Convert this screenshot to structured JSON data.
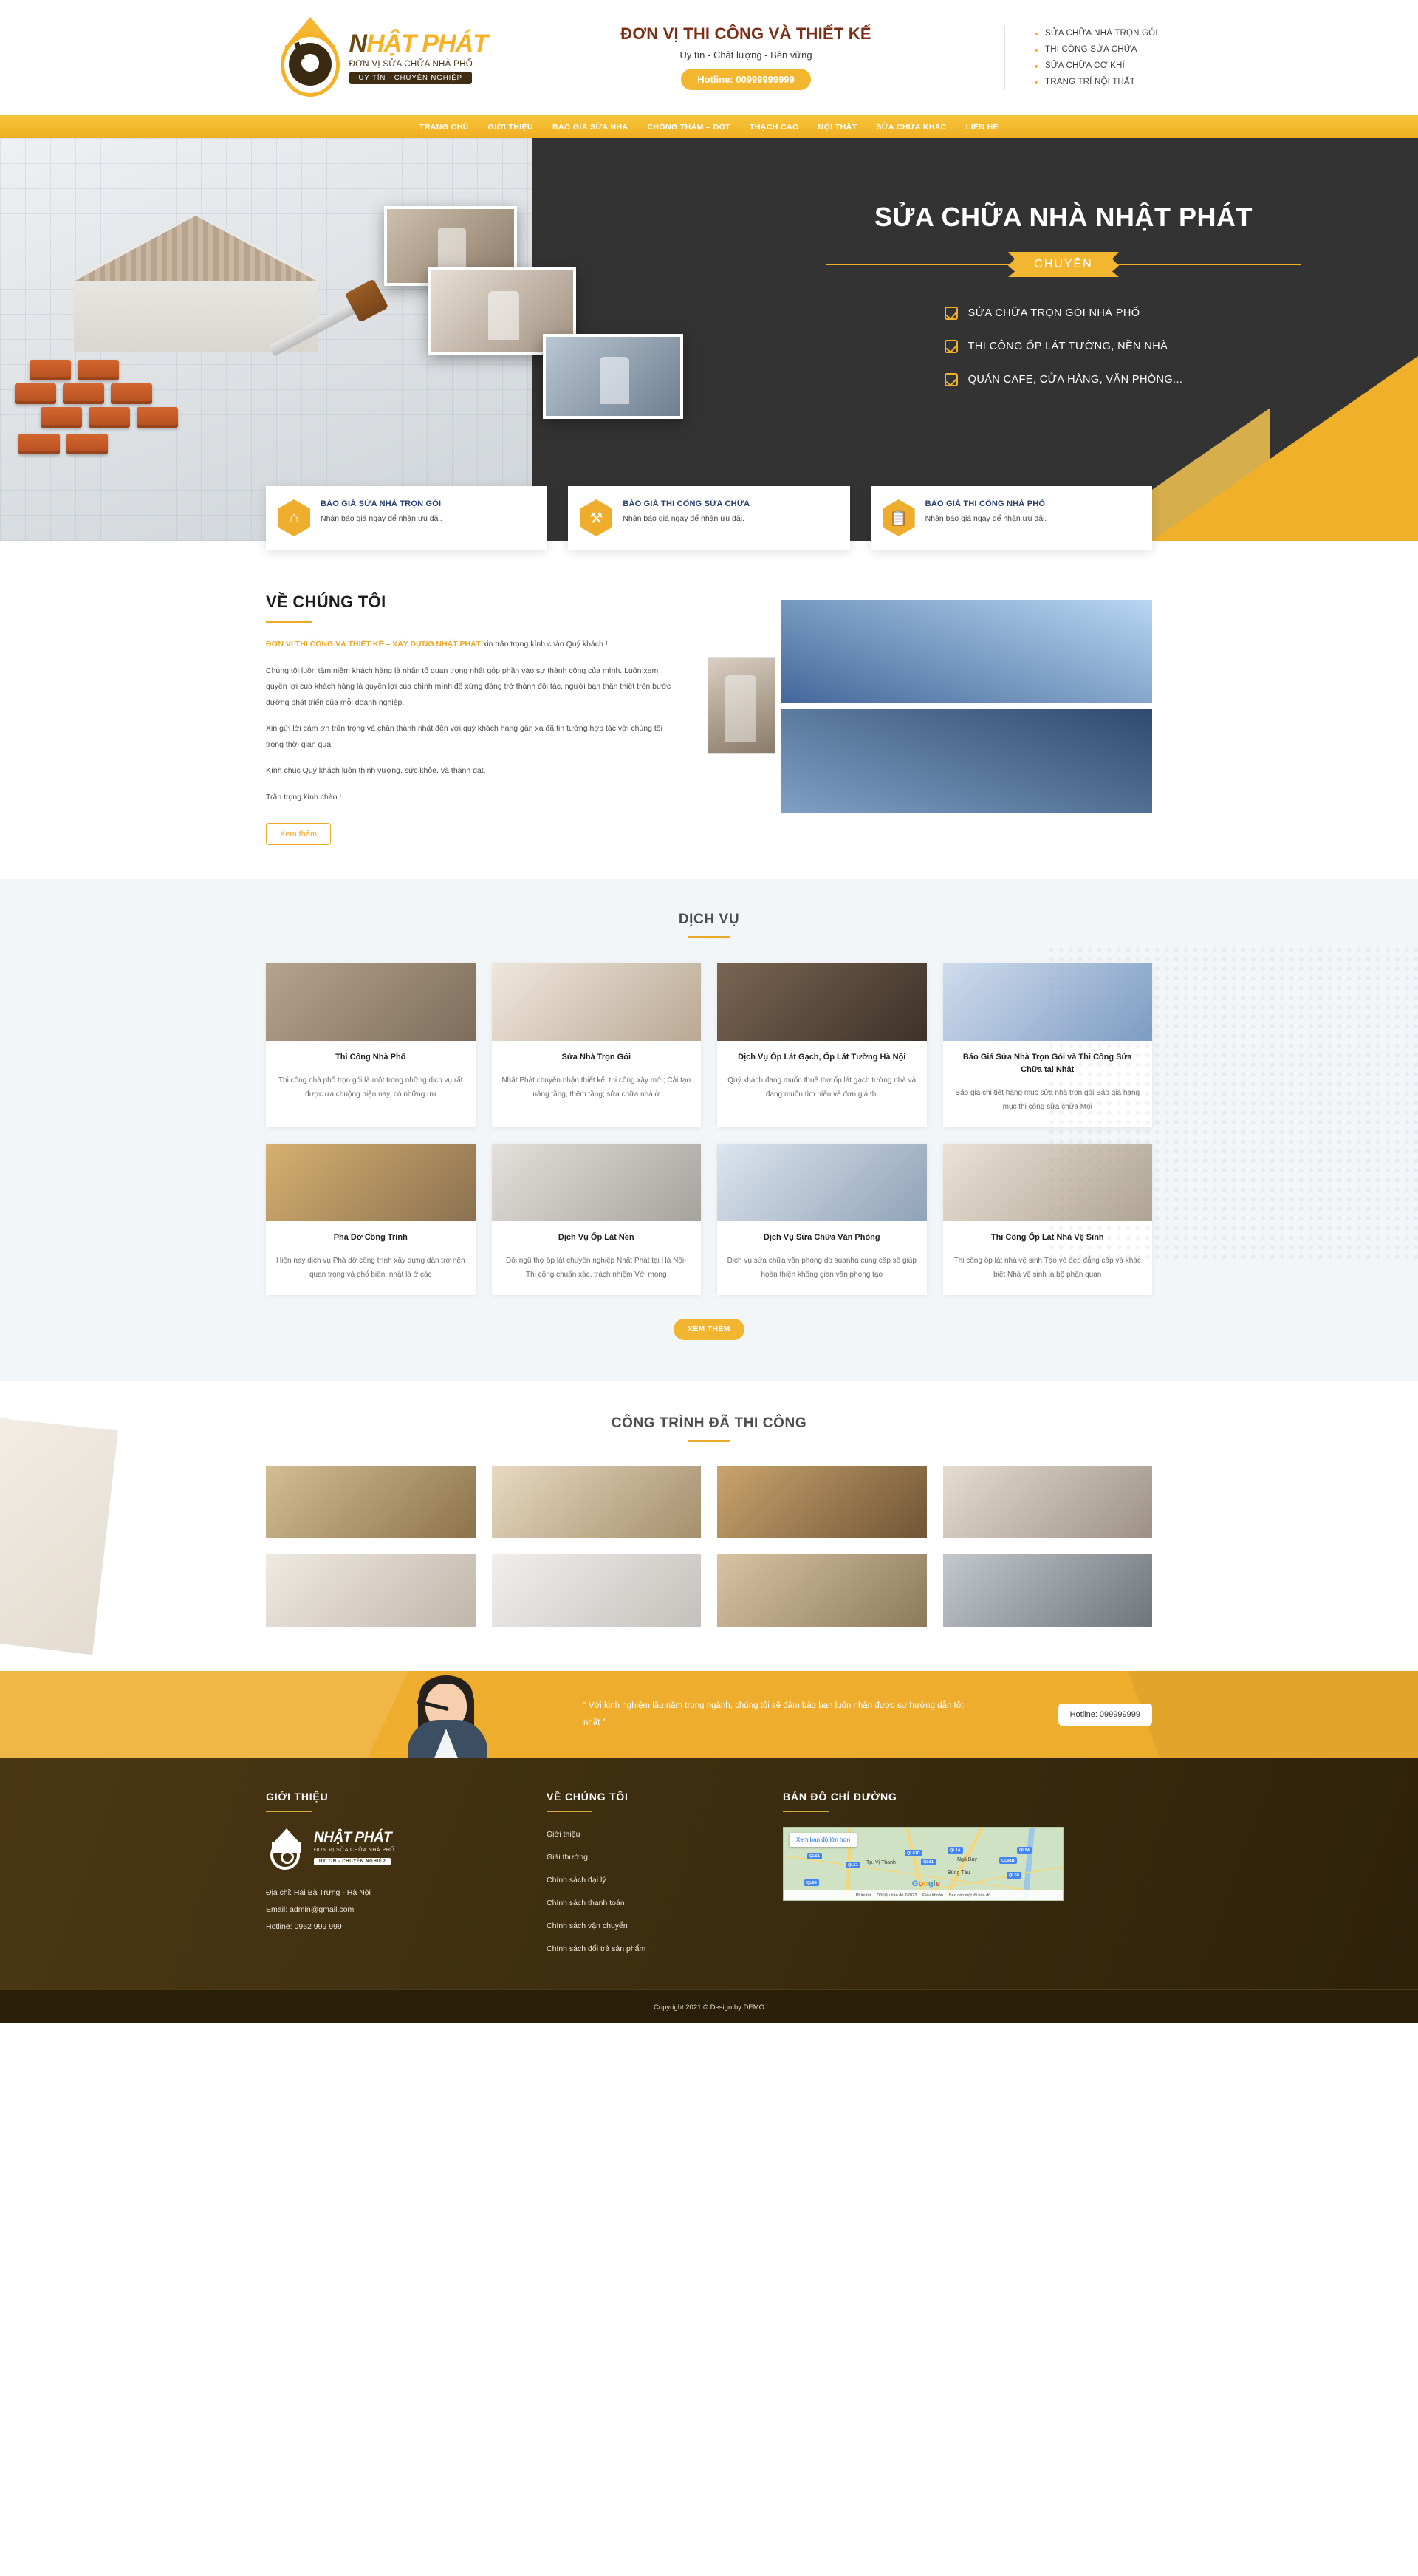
{
  "header": {
    "logo": {
      "name_first": "N",
      "name_rest": "HẬT PHÁT",
      "subtitle": "ĐƠN VỊ SỬA CHỮA NHÀ PHỐ",
      "badge": "UY TÍN - CHUYÊN NGHIỆP"
    },
    "center": {
      "title": "ĐƠN VỊ THI CÔNG VÀ THIẾT KẾ",
      "slogan": "Uy tín - Chất lượng - Bền vững",
      "hotline": "Hotline: 00999999999"
    },
    "services_list": [
      "SỬA CHỮA NHÀ TRỌN GÓI",
      "THI CÔNG SỬA CHỮA",
      "SỬA CHỮA CƠ KHÍ",
      "TRANG TRÍ NỘI THẤT"
    ]
  },
  "nav": {
    "items": [
      "TRANG CHỦ",
      "GIỚI THIỆU",
      "BÁO GIÁ SỬA NHÀ",
      "CHỐNG THẤM – DỘT",
      "THẠCH CAO",
      "NỘI THẤT",
      "SỬA CHỮA KHÁC",
      "LIÊN HỆ"
    ]
  },
  "hero": {
    "title": "SỬA CHỮA NHÀ NHẬT PHÁT",
    "ribbon": "CHUYÊN",
    "bullets": [
      "SỬA CHỮA TRỌN GÓI NHÀ PHỐ",
      "THI CÔNG ỐP LÁT TƯỜNG, NỀN NHÀ",
      "QUÁN CAFE, CỬA HÀNG, VĂN PHÒNG..."
    ]
  },
  "quote_cards": [
    {
      "icon": "house-icon",
      "title": "BÁO GIÁ SỬA NHÀ TRỌN GÓI",
      "desc": "Nhận báo giá ngay để nhận ưu đãi."
    },
    {
      "icon": "tools-icon",
      "title": "BÁO GIÁ THI CÔNG SỬA CHỮA",
      "desc": "Nhận báo giá ngay để nhận ưu đãi."
    },
    {
      "icon": "clipboard-icon",
      "title": "BÁO GIÁ THI CÔNG NHÀ PHỐ",
      "desc": "Nhận báo giá ngay để nhận ưu đãi."
    }
  ],
  "about": {
    "heading": "VỀ CHÚNG TÔI",
    "lead_highlight": "ĐƠN VỊ THI CÔNG VÀ THIẾT KẾ – XÂY DỰNG NHẬT PHÁT",
    "lead_rest": " xin trân trọng kính chào Quý khách !",
    "p1": "Chúng tôi luôn tâm niệm khách hàng là nhân tố quan trọng nhất góp phần vào sự thành công của mình. Luôn xem quyền lợi của khách hàng là quyền lợi của chính mình để xứng đáng trở thành đối tác, người bạn thân thiết trên bước đường phát triển của mỗi doanh nghiệp.",
    "p2": "Xin gửi lời cảm ơn trân trọng và chân thành nhất đến với quý khách hàng gần xa đã tin tưởng hợp tác với chúng tôi trong thời gian qua.",
    "p3": "Kính chúc Quý khách luôn thịnh vượng, sức khỏe, và thành đạt.",
    "p4": "Trân trọng kính chào !",
    "button": "Xem thêm"
  },
  "services": {
    "heading": "DỊCH VỤ",
    "more_button": "XEM THÊM",
    "cards": [
      {
        "title": "Thi Công Nhà Phố",
        "desc": "Thi công nhà phố trọn gói là một trong những dịch vụ rất được ưa chuộng hiện nay, có những ưu"
      },
      {
        "title": "Sửa Nhà Trọn Gói",
        "desc": "Nhật Phát chuyên nhận thiết kế; thi công xây mới; Cải tạo nâng tầng, thêm tầng; sửa chữa nhà ở"
      },
      {
        "title": "Dịch Vụ Ốp Lát Gạch, Ốp Lát Tường Hà Nội",
        "desc": "Quý khách đang muốn thuê thợ ốp lát gạch tường nhà và đang muốn tìm hiểu về đơn giá thi"
      },
      {
        "title": "Báo Giá Sửa Nhà Trọn Gói và Thi Công Sửa Chữa tại Nhật",
        "desc": "Báo giá chi tiết hạng mục sửa nhà trọn gói      Báo giá hạng mục thi công sửa chữa      Mọi"
      },
      {
        "title": "Phá Dỡ Công Trình",
        "desc": "Hiện nay dịch vụ Phá dỡ công trình xây dựng dần trở nên quan trọng và phổ biến, nhất là ở các"
      },
      {
        "title": "Dịch Vụ Ốp Lát Nền",
        "desc": "Đội ngũ thợ ốp lát chuyên nghiệp Nhật Phát tại Hà Nội- Thi công chuẩn xác, trách nhiệm Với mong"
      },
      {
        "title": "Dịch Vụ Sửa Chữa Văn Phòng",
        "desc": "Dịch vụ sửa chữa văn phòng do suanha cung cấp sẽ giúp hoàn thiện không gian văn phòng tạo"
      },
      {
        "title": "Thi Công Ốp Lát Nhà Vệ Sinh",
        "desc": "Thi công ốp lát nhà vệ sinh Tạo vẻ đẹp đẳng cấp và khác biệt Nhà vệ sinh là bộ phận quan"
      }
    ]
  },
  "projects": {
    "heading": "CÔNG TRÌNH ĐÃ THI CÔNG",
    "items": [
      "project-mosaic-floor",
      "project-marble-entry",
      "project-wood-door-mosaic",
      "project-stone-wall-shelf",
      "project-bathroom-tub",
      "project-modern-bathroom",
      "project-living-room-tv",
      "project-renovation-work"
    ]
  },
  "cta": {
    "quote": "“ Với kinh nghiệm lâu năm trong ngành, chúng tôi sẽ đảm bảo bạn luôn nhận được sự hướng dẫn tốt nhất ”",
    "hotline": "Hotline: 099999999"
  },
  "footer": {
    "col1": {
      "heading": "GIỚI THIỆU",
      "logo_title": "NHẬT PHÁT",
      "logo_sub": "ĐƠN VỊ SỬA CHỮA NHÀ PHỐ",
      "logo_badge": "UY TÍN - CHUYÊN NGHIỆP",
      "address": "Địa chỉ: Hai Bà Trưng - Hà Nội",
      "email": "Email: admin@gmail.com",
      "hotline": "Hotline: 0962 999 999"
    },
    "col2": {
      "heading": "VỀ CHÚNG TÔI",
      "links": [
        "Giới thiệu",
        "Giải thưởng",
        "Chính sách đại lý",
        "Chính sách thanh toán",
        "Chính sách vận chuyển",
        "Chính sách đổi trả sản phẩm"
      ]
    },
    "col3": {
      "heading": "BẢN ĐỒ CHỈ ĐƯỜNG",
      "map": {
        "view_larger": "Xem bản đồ lớn hơn",
        "road_tags": [
          "QL61",
          "QL61C",
          "QL1A",
          "QL54",
          "QL91B",
          "QL61",
          "QL61",
          "QL60",
          "QL63"
        ],
        "places": [
          "Tp. Vị Thanh",
          "Ngã Bảy",
          "Búng Tàu"
        ],
        "watermark": "Google",
        "footer_items": [
          "Phím tắt",
          "Dữ liệu bản đồ ©2023",
          "Điều khoản",
          "Báo cáo một lỗi bản đồ"
        ]
      }
    },
    "copyright": "Copyright 2021 © Design by DEMO"
  },
  "colors": {
    "brand_yellow": "#eead2c",
    "brand_dark": "#3b2c10",
    "hero_dark": "#333333",
    "section_bg": "#f2f6f8",
    "card_title": "#27406b"
  }
}
